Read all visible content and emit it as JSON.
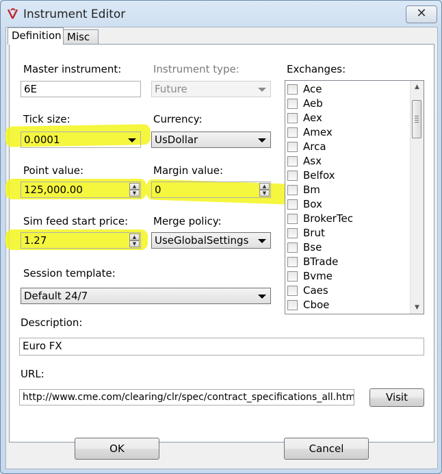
{
  "window": {
    "title": "Instrument Editor",
    "close_glyph": "✕"
  },
  "tabs": [
    {
      "label": "Definition"
    },
    {
      "label": "Misc"
    }
  ],
  "form": {
    "master_instrument": {
      "label": "Master instrument:",
      "value": "6E"
    },
    "instrument_type": {
      "label": "Instrument type:",
      "value": "Future"
    },
    "tick_size": {
      "label": "Tick size:",
      "value": "0.0001"
    },
    "currency": {
      "label": "Currency:",
      "value": "UsDollar"
    },
    "point_value": {
      "label": "Point value:",
      "value": "125,000.00"
    },
    "margin_value": {
      "label": "Margin value:",
      "value": "0"
    },
    "sim_feed_start_price": {
      "label": "Sim feed start price:",
      "value": "1.27"
    },
    "merge_policy": {
      "label": "Merge policy:",
      "value": "UseGlobalSettings"
    },
    "session_template": {
      "label": "Session template:",
      "value": "Default 24/7"
    },
    "description": {
      "label": "Description:",
      "value": "Euro FX"
    },
    "url": {
      "label": "URL:",
      "value": "http://www.cme.com/clearing/clr/spec/contract_specifications_all.html"
    }
  },
  "exchanges": {
    "label": "Exchanges:",
    "items": [
      "Ace",
      "Aeb",
      "Aex",
      "Amex",
      "Arca",
      "Asx",
      "Belfox",
      "Bm",
      "Box",
      "BrokerTec",
      "Brut",
      "Bse",
      "BTrade",
      "Bvme",
      "Caes",
      "Cboe"
    ]
  },
  "buttons": {
    "visit": "Visit",
    "ok": "OK",
    "cancel": "Cancel"
  },
  "colors": {
    "highlight": "#f3f51c",
    "logo_red": "#c0272d"
  },
  "icons": {
    "close": "close-icon",
    "dropdown": "chevron-down-icon",
    "spin": "spin-arrows-icon"
  }
}
